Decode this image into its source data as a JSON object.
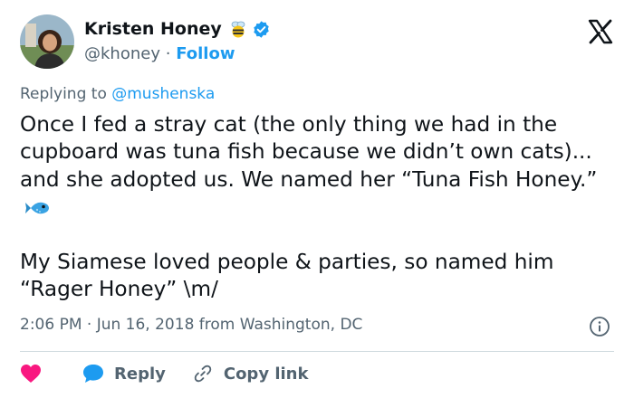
{
  "author": {
    "name": "Kristen Honey",
    "handle": "@khoney",
    "separator": "·",
    "follow_label": "Follow"
  },
  "replying": {
    "prefix": "Replying to",
    "mention": "@mushenska"
  },
  "tweet": {
    "paragraph1": "Once I fed a stray cat (the only thing we had in the cupboard was tuna fish because we didn’t own cats)... and she adopted us. We named her “Tuna Fish Honey.”",
    "paragraph2": "My Siamese loved people & parties, so named him “Rager Honey” \\m/"
  },
  "meta": {
    "time_location": "2:06 PM · Jun 16, 2018 from Washington, DC"
  },
  "actions": {
    "reply_label": "Reply",
    "copy_link_label": "Copy link"
  },
  "colors": {
    "accent": "#1d9bf0",
    "heart": "#f91880",
    "text": "#0f1419",
    "muted": "#536471"
  },
  "icons": [
    "avatar",
    "bee-icon",
    "verified-badge-icon",
    "x-logo-icon",
    "fish-icon",
    "info-icon",
    "heart-icon",
    "reply-bubble-icon",
    "link-icon"
  ]
}
